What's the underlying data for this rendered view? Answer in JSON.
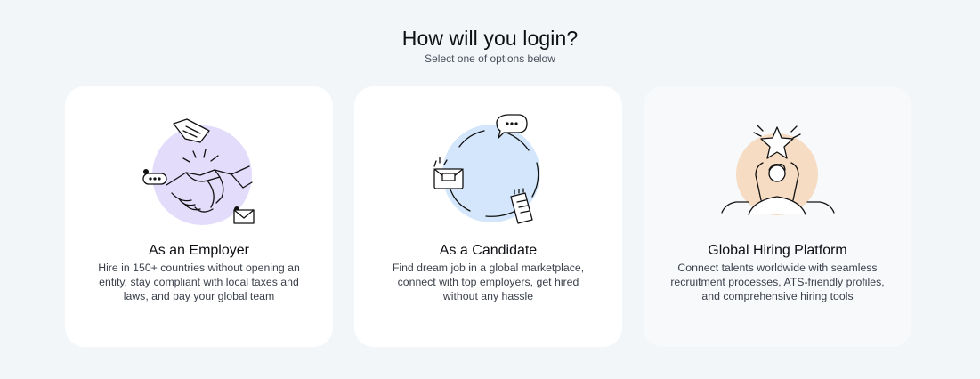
{
  "header": {
    "title": "How will you login?",
    "subtitle": "Select one of options below"
  },
  "options": [
    {
      "title": "As an Employer",
      "description": "Hire in 150+ countries without opening an entity, stay compliant with local taxes and laws, and pay your global team",
      "illustration": "handshake-illustration",
      "circle_color": "#e3dcfb"
    },
    {
      "title": "As a Candidate",
      "description": "Find dream job in a global marketplace, connect with top employers, get hired without any hassle",
      "illustration": "candidate-network-illustration",
      "circle_color": "#d3e6fb"
    },
    {
      "title": "Global Hiring Platform",
      "description": "Connect talents worldwide with seamless recruitment processes, ATS-friendly profiles, and comprehensive hiring tools",
      "illustration": "person-holding-star-illustration",
      "circle_color": "#f6dcc3"
    }
  ]
}
